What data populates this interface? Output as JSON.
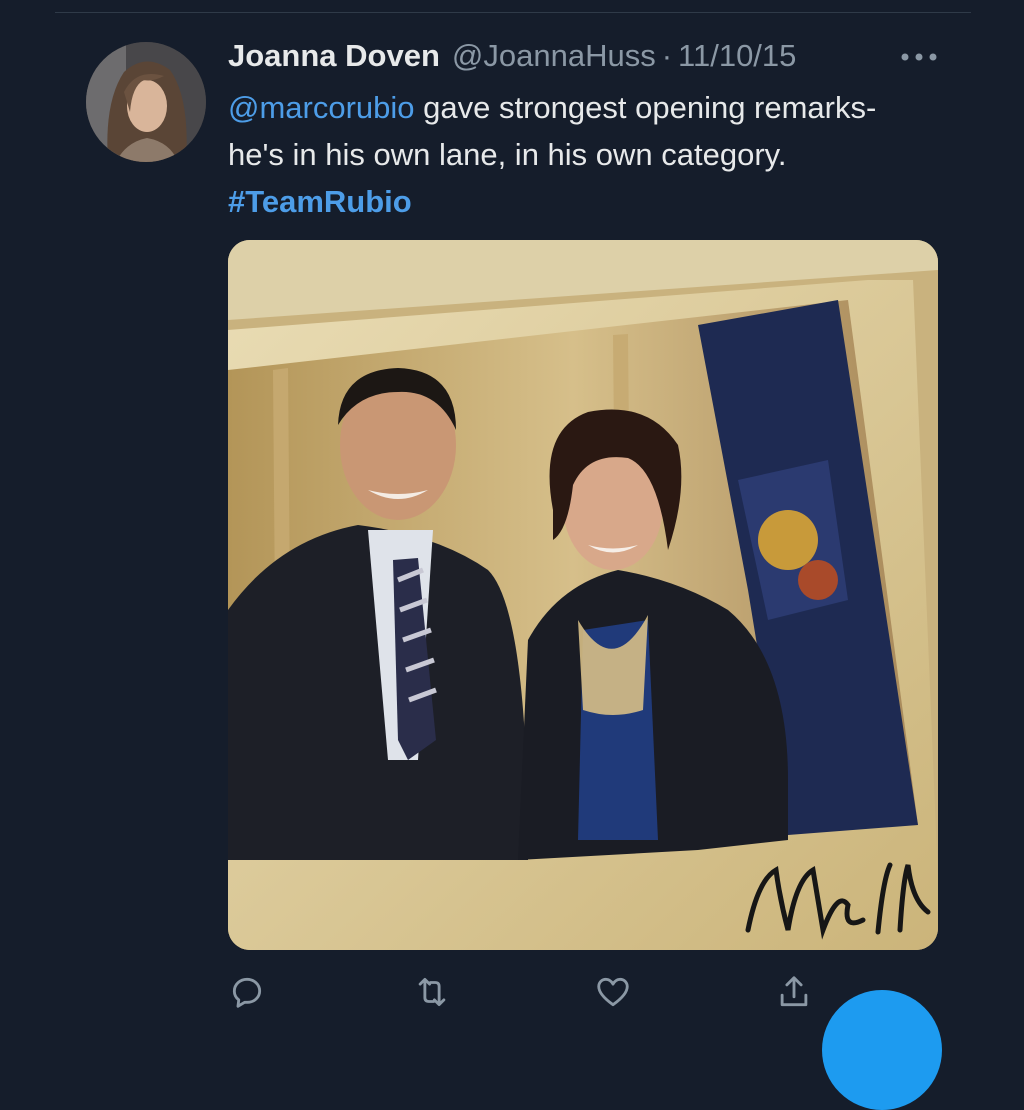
{
  "tweet": {
    "author": {
      "display_name": "Joanna Doven",
      "handle": "@JoannaHuss",
      "separator": "·",
      "date": "11/10/15"
    },
    "text": {
      "mention": "@marcorubio",
      "body": " gave strongest opening remarks- he's in his own lane, in his own category. ",
      "hashtag": "#TeamRubio"
    },
    "media": {
      "signature_text": "Marco Rubio"
    }
  },
  "icons": {
    "more": "more-horizontal-icon",
    "reply": "reply-icon",
    "retweet": "retweet-icon",
    "like": "heart-icon",
    "share": "share-icon"
  },
  "colors": {
    "background": "#151d2b",
    "link": "#4d9de8",
    "muted": "#8b98a5",
    "fab": "#1d9bf0"
  }
}
